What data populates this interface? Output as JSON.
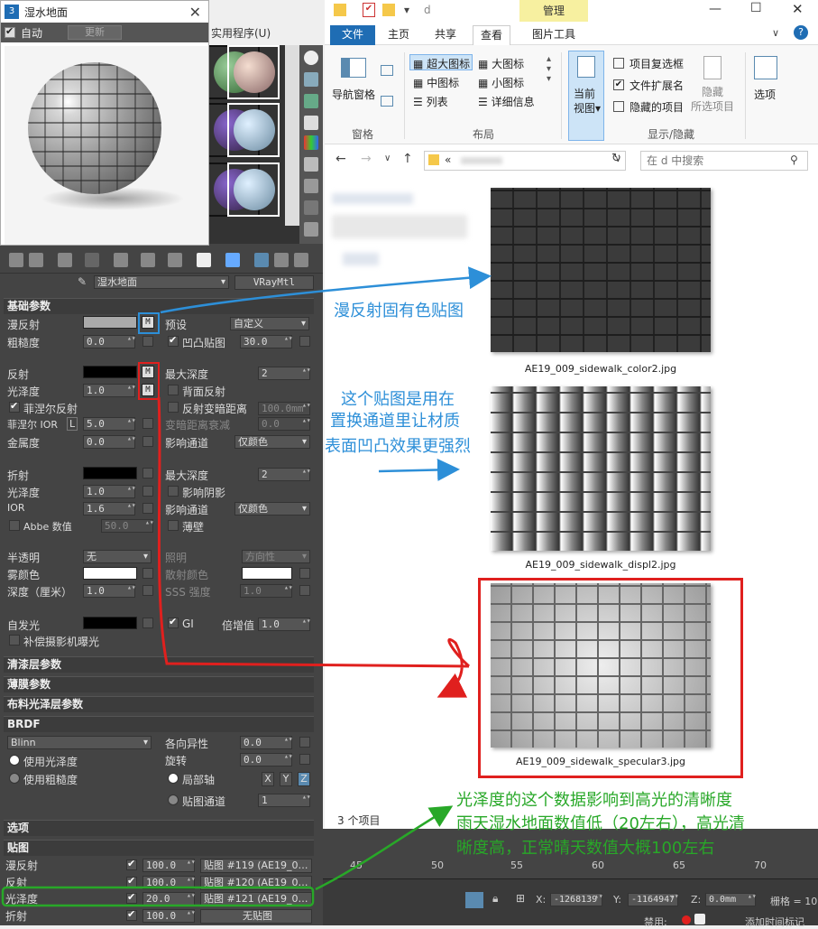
{
  "preview": {
    "title": "湿水地面",
    "auto_label": "自动",
    "update_label": "更新"
  },
  "bg_menu": "实用程序(U)",
  "material": {
    "name": "湿水地面",
    "type": "VRayMtl"
  },
  "basic": {
    "header": "基础参数",
    "diffuse": "漫反射",
    "preset": "预设",
    "preset_val": "自定义",
    "roughness": "粗糙度",
    "roughness_val": "0.0",
    "bump": "凹凸贴图",
    "bump_val": "30.0",
    "reflect": "反射",
    "max_depth": "最大深度",
    "max_depth_val": "2",
    "gloss": "光泽度",
    "gloss_val": "1.0",
    "backside": "背面反射",
    "fresnel": "菲涅尔反射",
    "dim_dist": "反射变暗距离",
    "dim_dist_val": "100.0mm",
    "fresnel_ior": "菲涅尔 IOR",
    "lock": "L",
    "fresnel_ior_val": "5.0",
    "dim_falloff": "变暗距离衰减",
    "dim_falloff_val": "0.0",
    "metal": "金属度",
    "metal_val": "0.0",
    "affect": "影响通道",
    "affect_val": "仅颜色",
    "refract": "折射",
    "r_max_depth": "最大深度",
    "r_max_depth_val": "2",
    "r_gloss": "光泽度",
    "r_gloss_val": "1.0",
    "shadows": "影响阴影",
    "ior": "IOR",
    "ior_val": "1.6",
    "r_affect": "影响通道",
    "r_affect_val": "仅颜色",
    "abbe": "Abbe 数值",
    "abbe_val": "50.0",
    "thin": "薄壁",
    "translucency": "半透明",
    "transl_val": "无",
    "illum": "照明",
    "illum_val": "方向性",
    "fog": "雾颜色",
    "scatter": "散射颜色",
    "depth": "深度（厘米）",
    "depth_val": "1.0",
    "sss": "SSS 强度",
    "sss_val": "1.0",
    "self_illum": "自发光",
    "gi": "GI",
    "mult": "倍增值",
    "mult_val": "1.0",
    "compensate": "补偿摄影机曝光"
  },
  "rollouts": {
    "coat": "清漆层参数",
    "sheen": "薄膜参数",
    "cloth": "布料光泽层参数",
    "brdf": "BRDF",
    "options": "选项",
    "maps": "贴图"
  },
  "brdf": {
    "type": "Blinn",
    "use_gloss": "使用光泽度",
    "use_rough": "使用粗糙度",
    "aniso": "各向异性",
    "aniso_val": "0.0",
    "rotation": "旋转",
    "rotation_val": "0.0",
    "local": "局部轴",
    "x": "X",
    "y": "Y",
    "z": "Z",
    "map_ch": "贴图通道",
    "map_ch_val": "1"
  },
  "maps": [
    {
      "name": "漫反射",
      "amount": "100.0",
      "map": "贴图 #119 (AE19_0…"
    },
    {
      "name": "反射",
      "amount": "100.0",
      "map": "贴图 #120 (AE19_0…"
    },
    {
      "name": "光泽度",
      "amount": "20.0",
      "map": "贴图 #121 (AE19_0…"
    },
    {
      "name": "折射",
      "amount": "100.0",
      "map": "无贴图"
    }
  ],
  "explorer": {
    "path": "d",
    "manage": "管理",
    "tabs": [
      "文件",
      "主页",
      "共享",
      "查看",
      "图片工具"
    ],
    "nav_pane": "导航窗格",
    "pane_group": "窗格",
    "layout": [
      "超大图标",
      "大图标",
      "中图标",
      "小图标",
      "列表",
      "详细信息"
    ],
    "layout_group": "布局",
    "current_view": "当前\n视图▾",
    "cb_item": "项目复选框",
    "cb_ext": "文件扩展名",
    "cb_hidden": "隐藏的项目",
    "hide_sel": "隐藏\n所选项目",
    "options": "选项",
    "showhide_group": "显示/隐藏",
    "addr": "«",
    "search": "在 d 中搜索",
    "count": "3 个项目",
    "files": [
      "AE19_009_sidewalk_color2.jpg",
      "AE19_009_sidewalk_displ2.jpg",
      "AE19_009_sidewalk_specular3.jpg"
    ]
  },
  "annotations": {
    "a1": "漫反射固有色贴图",
    "a2": [
      "这个贴图是用在",
      "置换通道里让材质",
      "表面凹凸效果更强烈"
    ],
    "a3": [
      "光泽度的这个数据影响到高光的清晰度",
      "雨天湿水地面数值低（20左右），高光清",
      "晰度高，正常晴天数值大概100左右"
    ]
  },
  "timeline": {
    "ticks": [
      "45",
      "50",
      "55",
      "60",
      "65",
      "70"
    ],
    "x": "X:",
    "x_val": "-1268139",
    "y": "Y:",
    "y_val": "-1164947",
    "z": "Z:",
    "z_val": "0.0mm",
    "grid": "栅格 = 10",
    "disabled": "禁用:",
    "add_time": "添加时间标记"
  },
  "colors": {
    "blue": "#2d8fd8",
    "red": "#e0201e",
    "green": "#28a828"
  }
}
